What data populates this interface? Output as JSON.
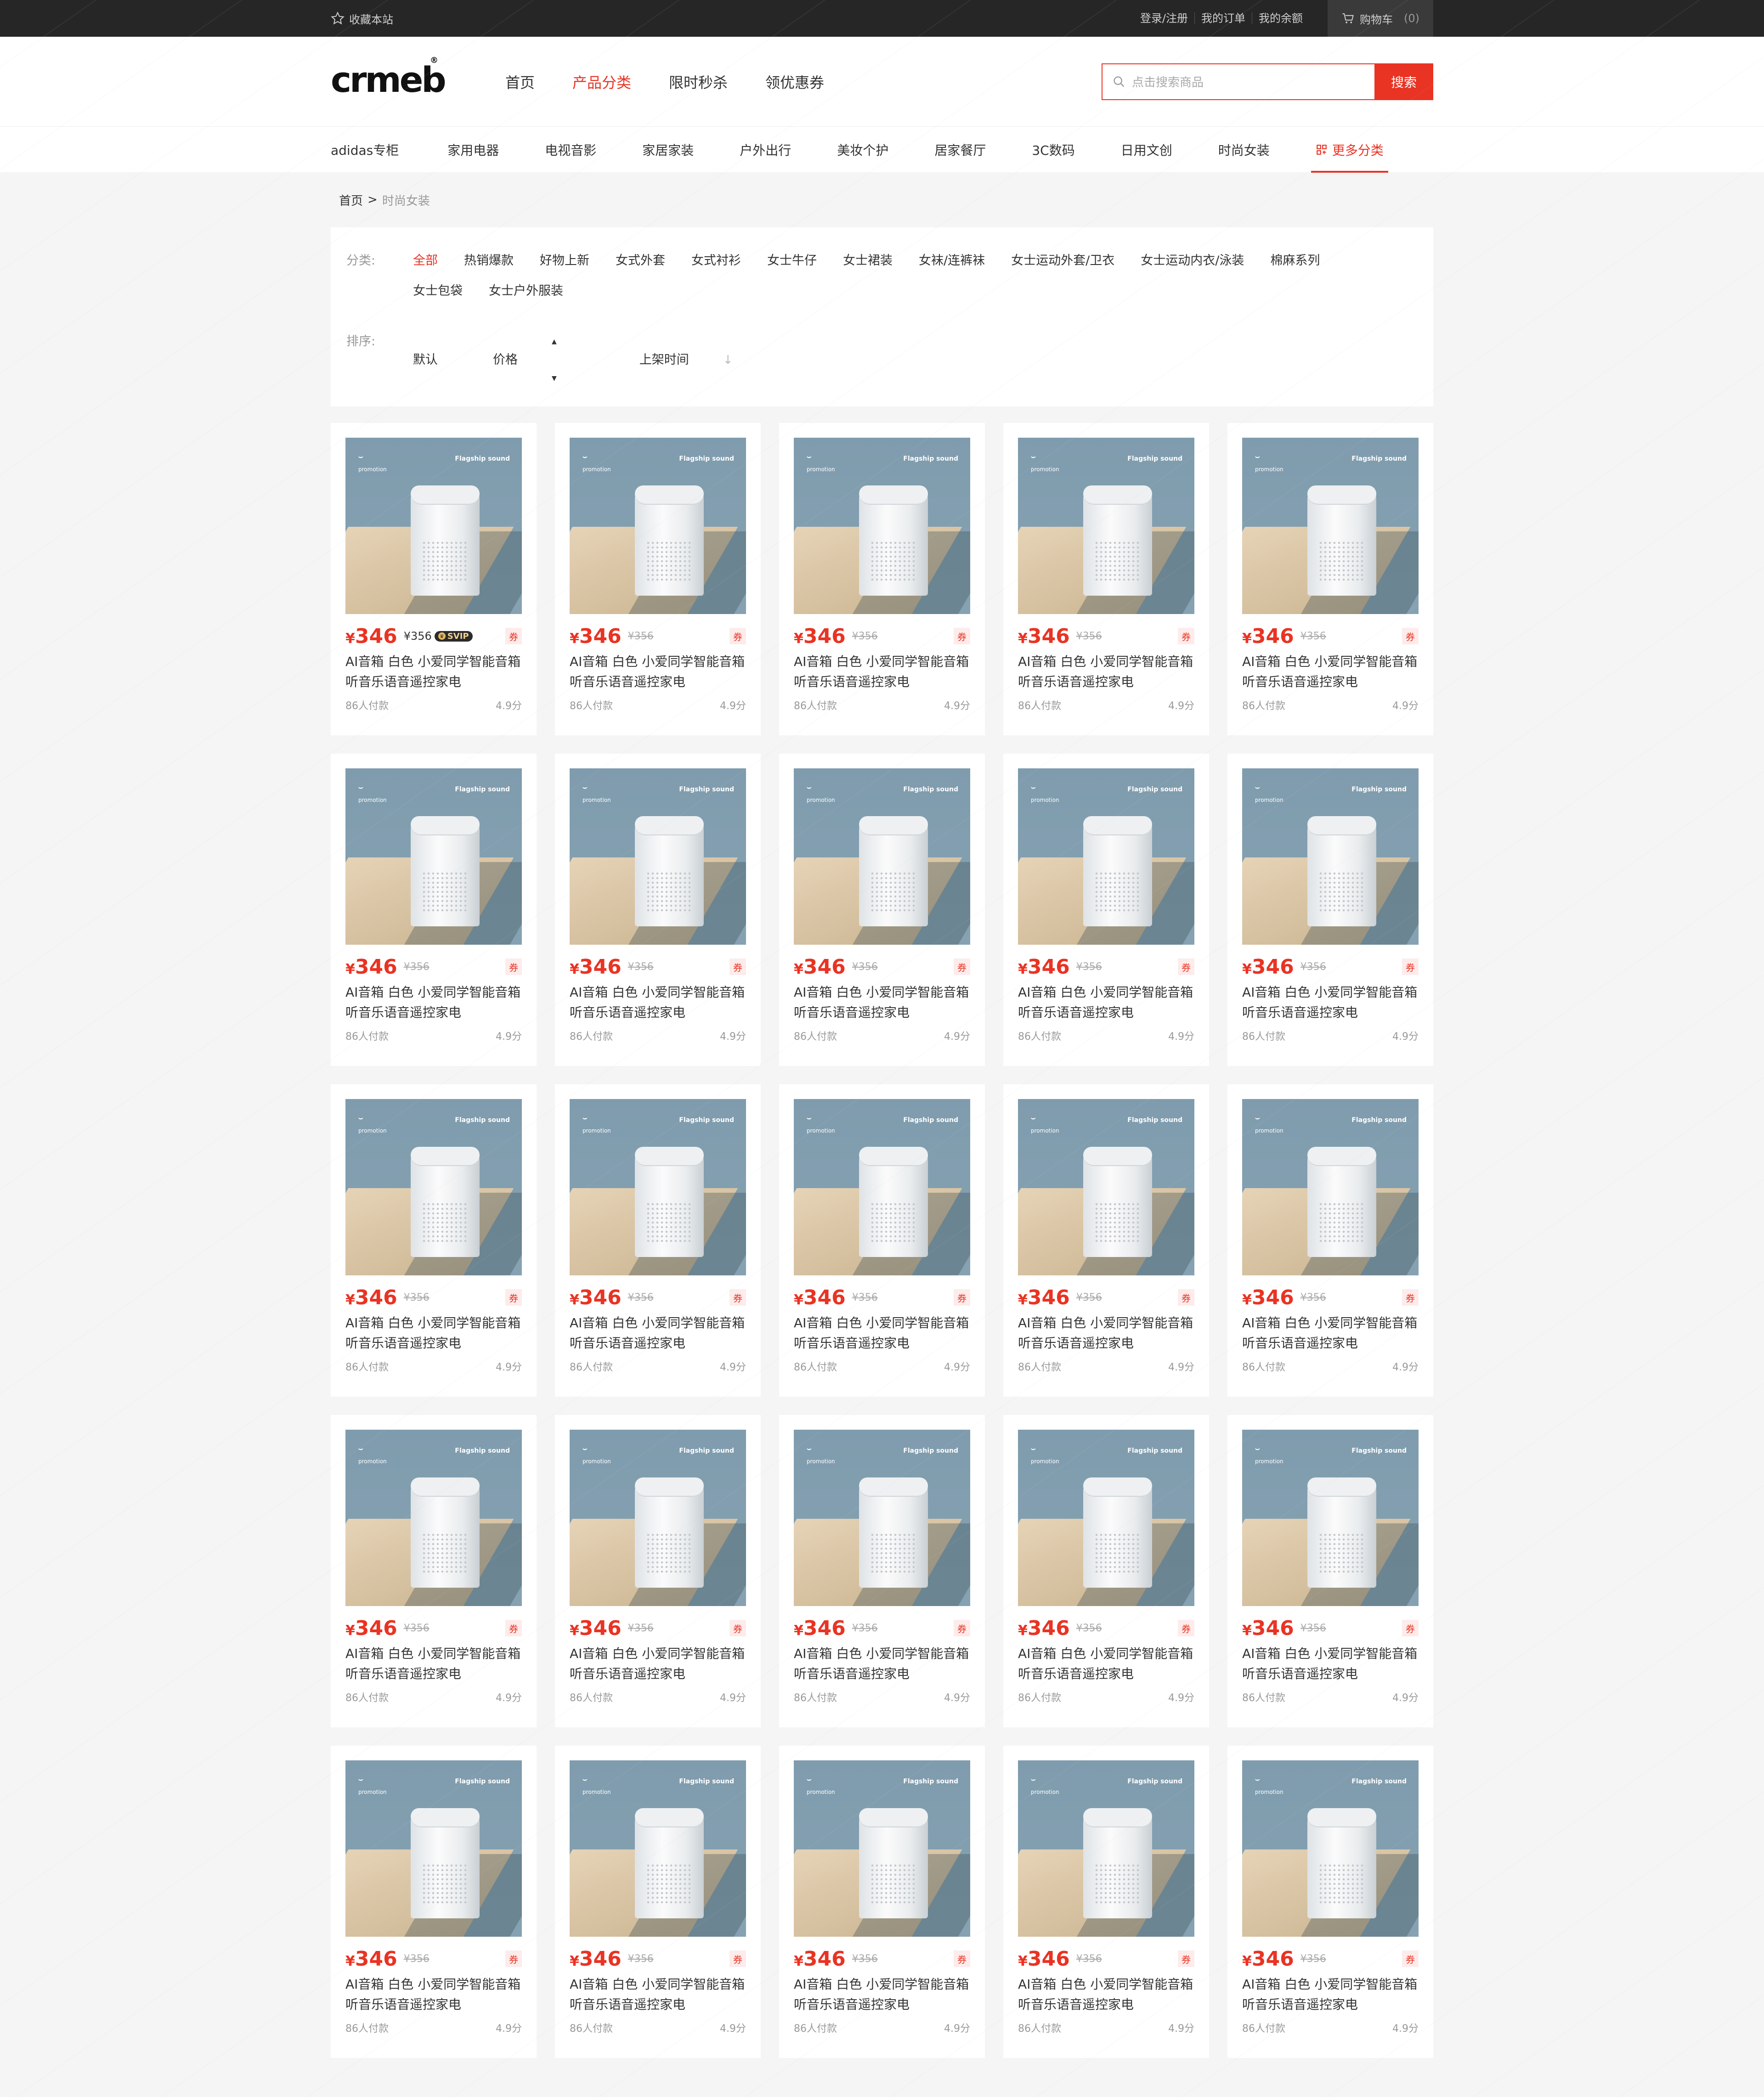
{
  "topbar": {
    "favorite": "收藏本站",
    "links": [
      "登录/注册",
      "我的订单",
      "我的余额"
    ],
    "cart_label": "购物车",
    "cart_count": "(0)"
  },
  "header": {
    "logo": "crmeb",
    "logo_mark": "®",
    "nav": [
      {
        "label": "首页",
        "active": false
      },
      {
        "label": "产品分类",
        "active": true
      },
      {
        "label": "限时秒杀",
        "active": false
      },
      {
        "label": "领优惠券",
        "active": false
      }
    ],
    "search_placeholder": "点击搜索商品",
    "search_button": "搜索"
  },
  "catnav": {
    "items": [
      "adidas专柜",
      "家用电器",
      "电视音影",
      "家居家装",
      "户外出行",
      "美妆个护",
      "居家餐厅",
      "3C数码",
      "日用文创",
      "时尚女装"
    ],
    "more": "更多分类"
  },
  "breadcrumb": {
    "home": "首页",
    "sep": ">",
    "current": "时尚女装"
  },
  "filter": {
    "category_label": "分类:",
    "categories": [
      "全部",
      "热销爆款",
      "好物上新",
      "女式外套",
      "女式衬衫",
      "女士牛仔",
      "女士裙装",
      "女袜/连裤袜",
      "女士运动外套/卫衣",
      "女士运动内衣/泳装",
      "棉麻系列",
      "女士包袋",
      "女士户外服装"
    ],
    "active_category": 0,
    "sort_label": "排序:",
    "sorts": [
      "默认",
      "价格",
      "上架时间"
    ]
  },
  "product": {
    "currency": "¥",
    "price": "346",
    "original_price": "¥356",
    "svip_badge": "SVIP",
    "coupon": "券",
    "name": "AI音箱 白色 小爱同学智能音箱听音乐语音遥控家电",
    "sales": "86人付款",
    "rating": "4.9分",
    "image_brand": "Flagship sound",
    "image_mi": "promotion"
  },
  "product_count": 25,
  "colors": {
    "accent": "#e93323",
    "topbar": "#262626",
    "background": "#f5f5f5"
  }
}
